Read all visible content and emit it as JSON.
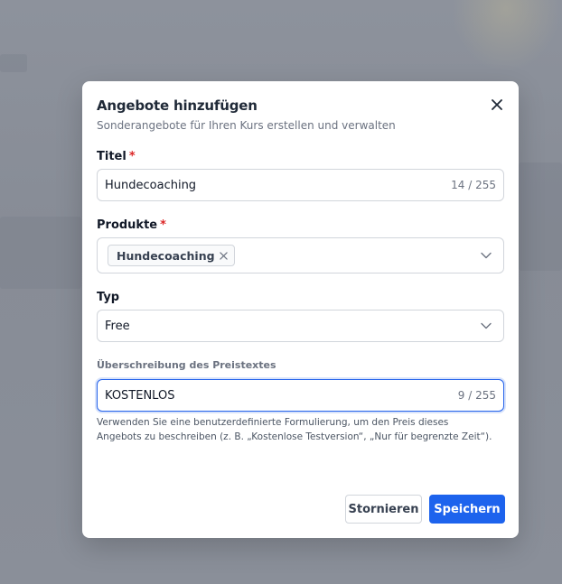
{
  "modal": {
    "title": "Angebote hinzufügen",
    "subtitle": "Sonderangebote für Ihren Kurs erstellen und verwalten"
  },
  "form": {
    "title": {
      "label": "Titel",
      "required_mark": "*",
      "value": "Hundecoaching",
      "counter": "14 / 255"
    },
    "products": {
      "label": "Produkte",
      "required_mark": "*",
      "selected": [
        "Hundecoaching"
      ]
    },
    "type": {
      "label": "Typ",
      "value": "Free"
    },
    "price_override": {
      "label": "Überschreibung des Preistextes",
      "value": "KOSTENLOS",
      "counter": "9 / 255",
      "help": "Verwenden Sie eine benutzerdefinierte Formulierung, um den Preis dieses Angebots zu beschreiben (z. B. „Kostenlose Testversion“, „Nur für begrenzte Zeit“)."
    }
  },
  "actions": {
    "cancel_label": "Stornieren",
    "save_label": "Speichern"
  },
  "colors": {
    "accent": "#1d63ed",
    "required": "#dc2626"
  },
  "icons": {
    "close": "close-icon",
    "chevron": "chevron-down-icon",
    "tag_remove": "close-icon"
  }
}
